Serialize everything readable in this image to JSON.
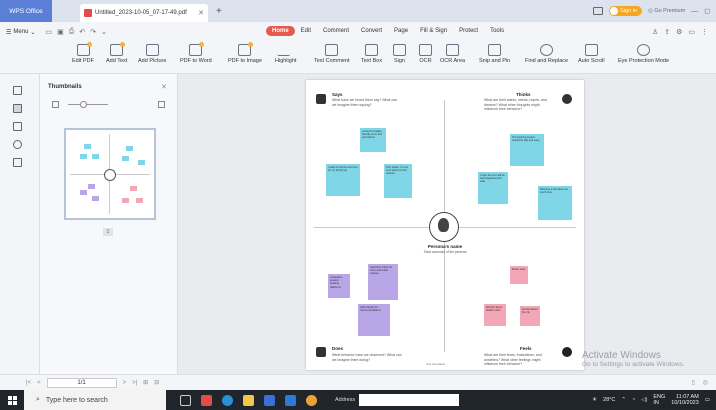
{
  "titlebar": {
    "app_tab": "WPS Office",
    "doc_tab": "Untitled_2023-10-05_07-17-49.pdf",
    "new_tab": "+",
    "signin": "Sign in",
    "premium": "Go Premium"
  },
  "menubar": {
    "menu": "Menu",
    "tabs": [
      "Home",
      "Edit",
      "Comment",
      "Convert",
      "Page",
      "Fill & Sign",
      "Protect",
      "Tools"
    ]
  },
  "ribbon": {
    "tools": [
      "Edit PDF",
      "Add Text",
      "Add Picture",
      "PDF to Word",
      "PDF to Image",
      "Highlight",
      "Text Comment",
      "Text Box",
      "Sign",
      "OCR",
      "OCR Area",
      "Snip and Pin",
      "Find and Replace",
      "Auto Scroll",
      "Eye Protection Mode"
    ]
  },
  "sidebar": {
    "title": "Thumbnails",
    "page_badge": "1"
  },
  "document": {
    "quadrants": {
      "says": {
        "title": "Says",
        "sub": "What have we heard them say? What can we imagine them saying?"
      },
      "thinks": {
        "title": "Thinks",
        "sub": "What are their wants, needs, hopes, and dreams? What other thoughts might influence their behavior?"
      },
      "does": {
        "title": "Does",
        "sub": "What behavior have we observed? What can we imagine them doing?"
      },
      "feels": {
        "title": "Feels",
        "sub": "What are their fears, frustrations, and anxieties? What other feelings might influence their behavior?"
      }
    },
    "persona_name": "Persona's name",
    "persona_sub": "Short summary of the persona",
    "credit": "Use templates",
    "notes": {
      "n1": "Looks for budget-friendly tours and promotions",
      "n2": "I want to find the best tour for my family trip",
      "n3": "Tour Guide: I'm not sure where to find reviews",
      "n4": "The booking system should be fast and easy",
      "n5": "I hope the tour will be well organized and safe",
      "n6": "Planning a trip takes too much time",
      "n7": "I need to compare prices",
      "n8": "I want good deals with details",
      "n9": "Searches online for tours and reads reviews",
      "n10": "Compares several booking platforms",
      "n11": "Asks friends for recommendations",
      "n12": "Books early",
      "n13": "Worried about hidden costs",
      "n14": "Excited about the trip"
    }
  },
  "watermark": {
    "line1": "Activate Windows",
    "line2": "Go to Settings to activate Windows."
  },
  "statusbar": {
    "page": "1/1"
  },
  "taskbar": {
    "search_placeholder": "Type here to search",
    "address_label": "Address",
    "temp": "28°C",
    "lang1": "ENG",
    "lang2": "IN",
    "time": "11:07 AM",
    "date": "10/10/2023"
  }
}
